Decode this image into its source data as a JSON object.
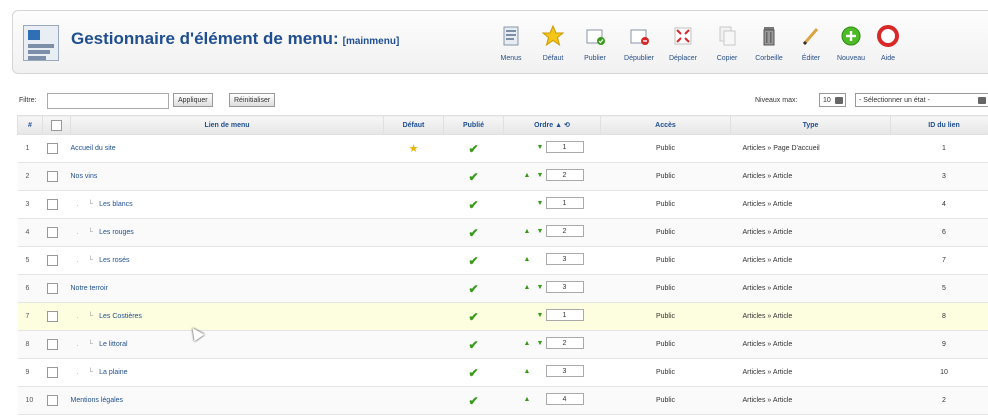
{
  "header": {
    "title": "Gestionnaire d'élément de menu:",
    "subtitle": "[mainmenu]"
  },
  "toolbar": {
    "buttons": [
      {
        "label": "Menus",
        "icon": "menus-icon"
      },
      {
        "label": "Défaut",
        "icon": "star-icon"
      },
      {
        "label": "Publier",
        "icon": "publish-icon"
      },
      {
        "label": "Dépublier",
        "icon": "unpublish-icon"
      },
      {
        "label": "Déplacer",
        "icon": "move-icon"
      },
      {
        "label": "Copier",
        "icon": "copy-icon"
      },
      {
        "label": "Corbeille",
        "icon": "trash-icon"
      },
      {
        "label": "Éditer",
        "icon": "edit-icon"
      },
      {
        "label": "Nouveau",
        "icon": "new-icon"
      },
      {
        "label": "Aide",
        "icon": "help-icon"
      }
    ]
  },
  "filter": {
    "label": "Filtre:",
    "value": "",
    "apply_label": "Appliquer",
    "reset_label": "Réinitialiser",
    "levels_label": "Niveaux max",
    "levels_value": "10",
    "state_label": "- Sélectionner un état -"
  },
  "table": {
    "headers": {
      "num": "#",
      "link": "Lien de menu",
      "default": "Défaut",
      "published": "Publié",
      "order": "Ordre",
      "access": "Accès",
      "type": "Type",
      "id": "ID du lien"
    },
    "rows": [
      {
        "num": "1",
        "title": "Accueil du site",
        "level": 0,
        "default": true,
        "up": false,
        "down": true,
        "order": "1",
        "access": "Public",
        "type": "Articles » Page D'accueil",
        "id": "1"
      },
      {
        "num": "2",
        "title": "Nos vins",
        "level": 0,
        "default": false,
        "up": true,
        "down": true,
        "order": "2",
        "access": "Public",
        "type": "Articles » Article",
        "id": "3"
      },
      {
        "num": "3",
        "title": "Les blancs",
        "level": 1,
        "default": false,
        "up": false,
        "down": true,
        "order": "1",
        "access": "Public",
        "type": "Articles » Article",
        "id": "4"
      },
      {
        "num": "4",
        "title": "Les rouges",
        "level": 1,
        "default": false,
        "up": true,
        "down": true,
        "order": "2",
        "access": "Public",
        "type": "Articles » Article",
        "id": "6"
      },
      {
        "num": "5",
        "title": "Les rosés",
        "level": 1,
        "default": false,
        "up": true,
        "down": false,
        "order": "3",
        "access": "Public",
        "type": "Articles » Article",
        "id": "7"
      },
      {
        "num": "6",
        "title": "Notre terroir",
        "level": 0,
        "default": false,
        "up": true,
        "down": true,
        "order": "3",
        "access": "Public",
        "type": "Articles » Article",
        "id": "5"
      },
      {
        "num": "7",
        "title": "Les Costières",
        "level": 1,
        "default": false,
        "up": false,
        "down": true,
        "order": "1",
        "access": "Public",
        "type": "Articles » Article",
        "id": "8",
        "highlight": true
      },
      {
        "num": "8",
        "title": "Le littoral",
        "level": 1,
        "default": false,
        "up": true,
        "down": true,
        "order": "2",
        "access": "Public",
        "type": "Articles » Article",
        "id": "9"
      },
      {
        "num": "9",
        "title": "La plaine",
        "level": 1,
        "default": false,
        "up": true,
        "down": false,
        "order": "3",
        "access": "Public",
        "type": "Articles » Article",
        "id": "10"
      },
      {
        "num": "10",
        "title": "Mentions légales",
        "level": 0,
        "default": false,
        "up": true,
        "down": false,
        "order": "4",
        "access": "Public",
        "type": "Articles » Article",
        "id": "2"
      }
    ]
  },
  "colors": {
    "title": "#1f4f91",
    "check": "#3a9b1b",
    "star": "#e5b300",
    "highlight_row": "#fdfde0"
  }
}
